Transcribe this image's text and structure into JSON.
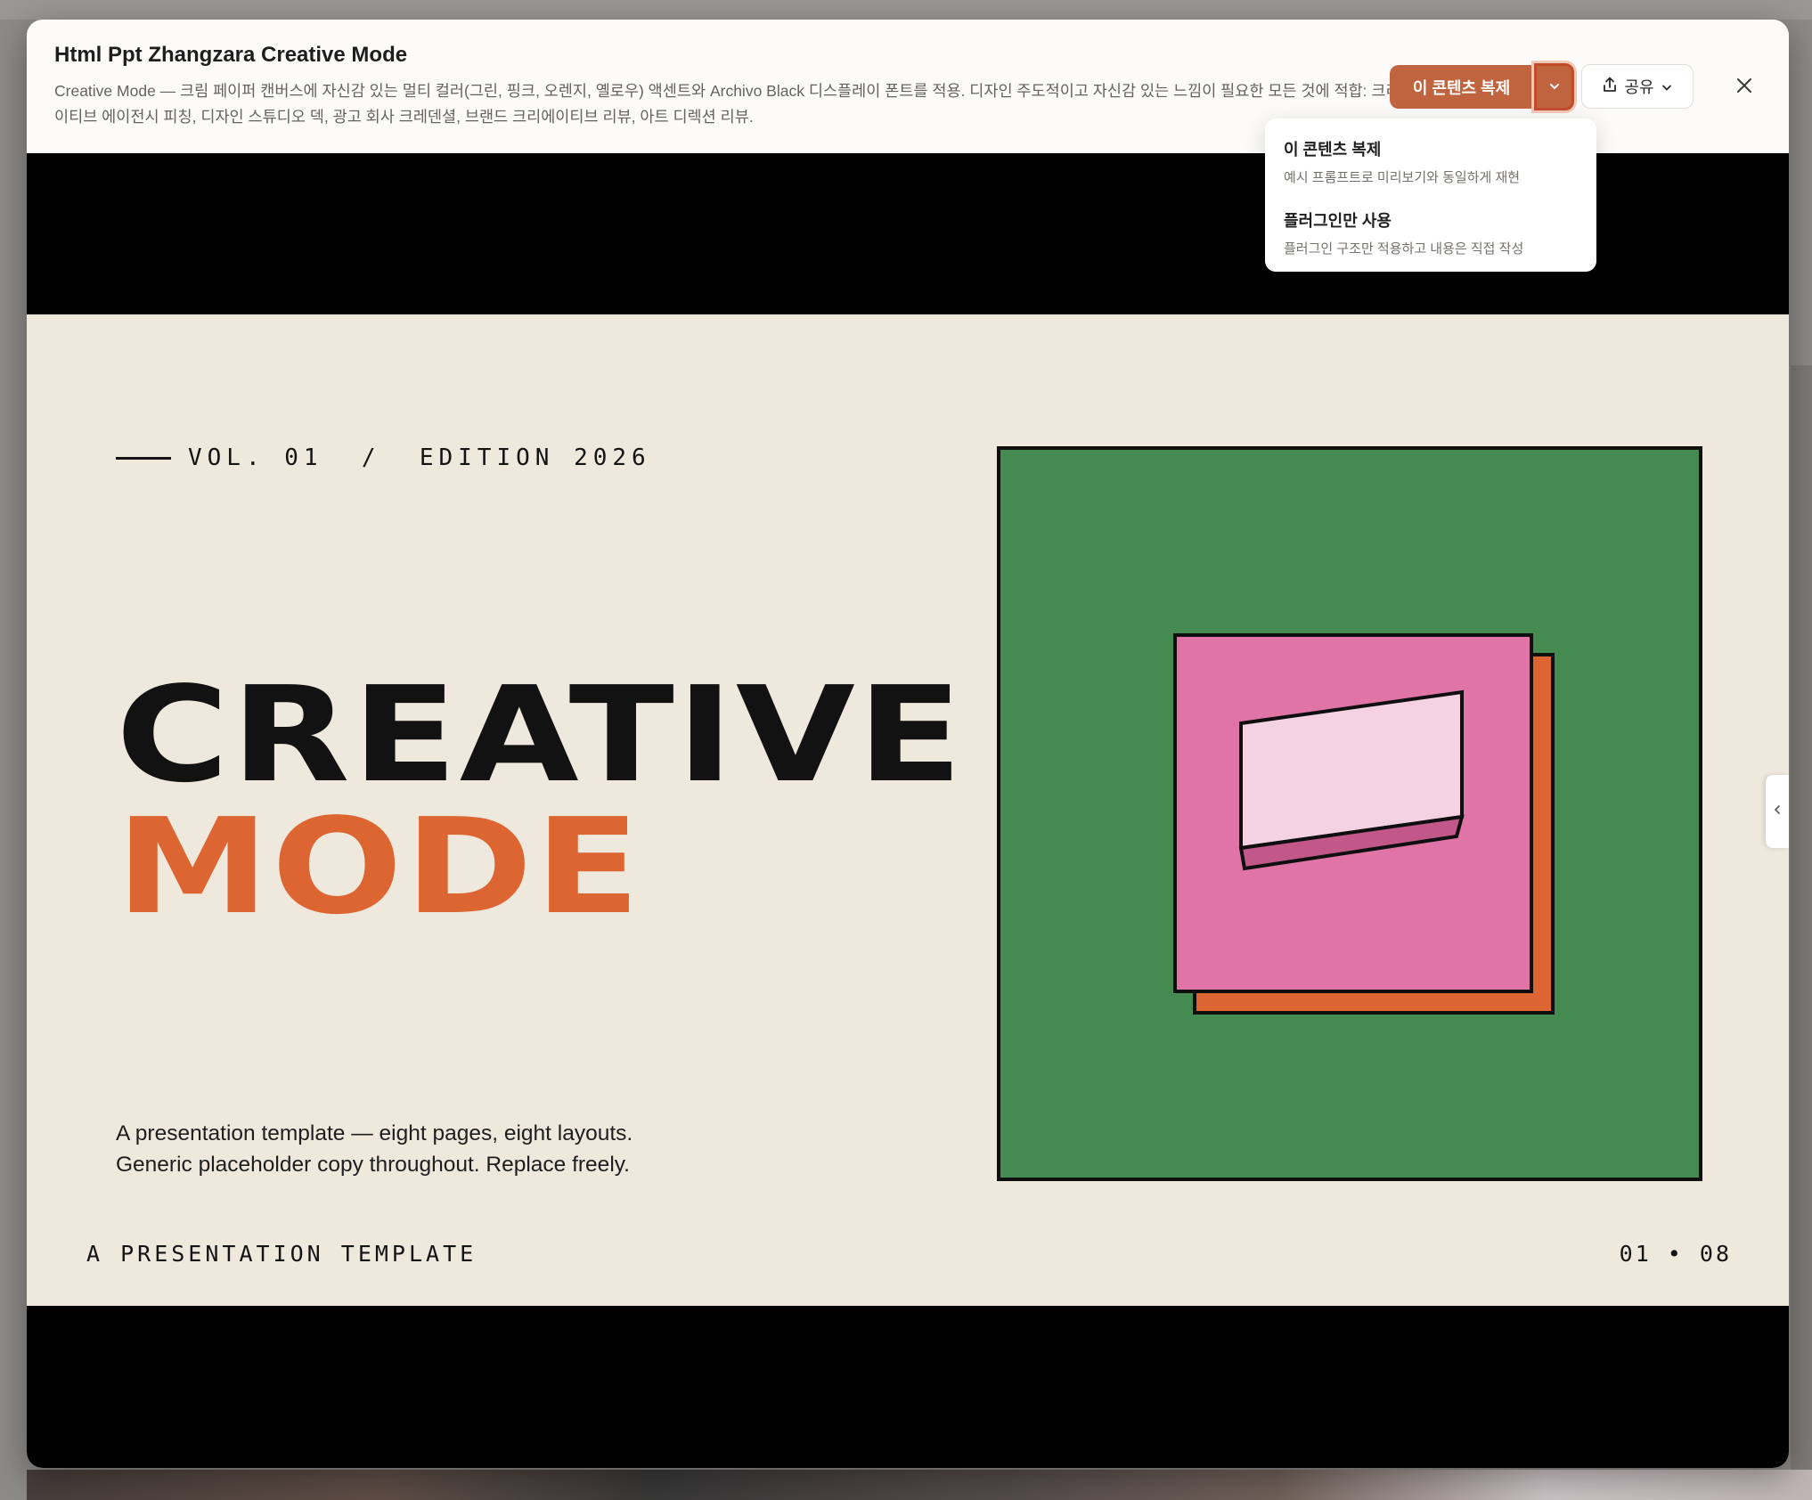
{
  "modal": {
    "title": "Html Ppt Zhangzara Creative Mode",
    "description": "Creative Mode — 크림 페이퍼 캔버스에 자신감 있는 멀티 컬러(그린, 핑크, 오렌지, 옐로우) 액센트와 Archivo Black 디스플레이 폰트를 적용. 디자인 주도적이고 자신감 있는 느낌이 필요한 모든 것에 적합: 크리에이티브 에이전시 피칭, 디자인 스튜디오 덱, 광고 회사 크레덴셜, 브랜드 크리에이티브 리뷰, 아트 디렉션 리뷰."
  },
  "toolbar": {
    "duplicate_label": "이 콘텐츠 복제",
    "share_label": "공유",
    "caret_icon": "chevron-down-icon",
    "share_icon": "share-upload-icon",
    "close_icon": "close-icon"
  },
  "dropdown": {
    "items": [
      {
        "title": "이 콘텐츠 복제",
        "subtitle": "예시 프롬프트로 미리보기와 동일하게 재현"
      },
      {
        "title": "플러그인만 사용",
        "subtitle": "플러그인 구조만 적용하고 내용은 직접 작성"
      }
    ]
  },
  "slide": {
    "kicker": "VOL. 01  /  EDITION 2026",
    "title_line1": "CREATIVE",
    "title_line2": "MODE",
    "body_line1": "A presentation template — eight pages, eight layouts.",
    "body_line2": "Generic placeholder copy throughout. Replace freely.",
    "footer_left": "A PRESENTATION TEMPLATE",
    "footer_right": "01 • 08"
  },
  "colors": {
    "accent_button": "#c0643f",
    "canvas_cream": "#efe8dc",
    "accent_orange": "#dc6531",
    "art_green": "#448a51",
    "art_pink": "#e074a6",
    "art_light_pink": "#f4d2e1",
    "art_dark_pink": "#c2578a",
    "ink": "#121212"
  },
  "side_tab": {
    "icon": "chevron-left-icon"
  }
}
